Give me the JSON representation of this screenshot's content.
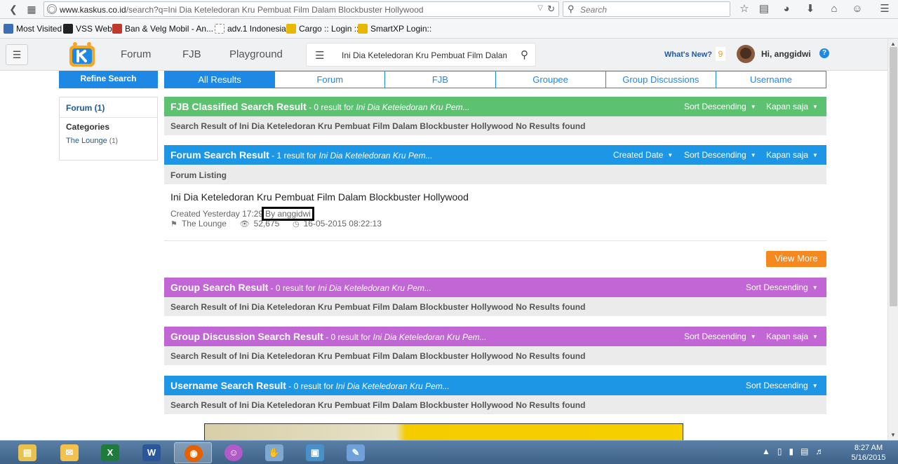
{
  "browser": {
    "url_domain": "www.kaskus.co.id",
    "url_path": "/search?q=Ini Dia Keteledoran Kru Pembuat Film Dalam Blockbuster Hollywood",
    "search_placeholder": "Search"
  },
  "bookmarks": [
    {
      "label": "Most Visited",
      "color": "#3b6fb6"
    },
    {
      "label": "VSS Web",
      "color": "#222222"
    },
    {
      "label": "Ban & Velg Mobil - An...",
      "color": "#c0392b"
    },
    {
      "label": "adv.1 Indonesia",
      "color": "#ffffff"
    },
    {
      "label": "Cargo :: Login ::",
      "color": "#e6b800"
    },
    {
      "label": "SmartXP Login::",
      "color": "#e6b800"
    }
  ],
  "header": {
    "nav": [
      "Forum",
      "FJB",
      "Playground"
    ],
    "search_value": "Ini Dia Keteledoran Kru Pembuat Film Dalam Blockbuster Hollywood",
    "whats_new": "What's New?",
    "notif_count": "9",
    "greeting": "Hi, anggidwi",
    "help": "?"
  },
  "sidebar": {
    "refine_label": "Refine Search",
    "forum_filter": "Forum (1)",
    "categories_heading": "Categories",
    "category_item": "The Lounge",
    "category_count": "(1)"
  },
  "tabs": [
    "All Results",
    "Forum",
    "FJB",
    "Groupee",
    "Group Discussions",
    "Username"
  ],
  "sections": {
    "fjb": {
      "title": "FJB Classified Search Result",
      "sub_prefix": " - 0 result for ",
      "sub_query": "Ini Dia Keteledoran Kru Pem...",
      "sort": "Sort Descending",
      "time": "Kapan saja",
      "no_result": "Search Result of Ini Dia Keteledoran Kru Pembuat Film Dalam Blockbuster Hollywood No Results found"
    },
    "forum": {
      "title": "Forum Search Result",
      "sub_prefix": " - 1 result for ",
      "sub_query": "Ini Dia Keteledoran Kru Pem...",
      "created_date": "Created Date",
      "sort": "Sort Descending",
      "time": "Kapan saja",
      "listing_heading": "Forum Listing",
      "item": {
        "title": "Ini Dia Keteledoran Kru Pembuat Film Dalam Blockbuster Hollywood",
        "created": "Created Yesterday 17:29",
        "by": "By anggidwi",
        "category": "The Lounge",
        "views": "52,675",
        "last_post": "16-05-2015 08:22:13"
      },
      "view_more": "View More"
    },
    "group": {
      "title": "Group Search Result",
      "sub_prefix": " - 0 result for ",
      "sub_query": "Ini Dia Keteledoran Kru Pem...",
      "sort": "Sort Descending",
      "no_result": "Search Result of Ini Dia Keteledoran Kru Pembuat Film Dalam Blockbuster Hollywood No Results found"
    },
    "group_discussion": {
      "title": "Group Discussion Search Result",
      "sub_prefix": " - 0 result for ",
      "sub_query": "Ini Dia Keteledoran Kru Pem...",
      "sort": "Sort Descending",
      "time": "Kapan saja",
      "no_result": "Search Result of Ini Dia Keteledoran Kru Pembuat Film Dalam Blockbuster Hollywood No Results found"
    },
    "username": {
      "title": "Username Search Result",
      "sub_prefix": " - 0 result for ",
      "sub_query": "Ini Dia Keteledoran Kru Pem...",
      "sort": "Sort Descending",
      "no_result": "Search Result of Ini Dia Keteledoran Kru Pembuat Film Dalam Blockbuster Hollywood No Results found"
    }
  },
  "colors": {
    "fjb_header": "#5cc171",
    "forum_header": "#1e96e6",
    "group_header": "#c266d6",
    "view_more": "#f5891f",
    "tab_accent": "#1e88e5"
  },
  "taskbar": {
    "apps": [
      "file-explorer",
      "outlook",
      "excel",
      "word",
      "firefox",
      "messenger",
      "hand-tool",
      "photo-viewer",
      "paint"
    ],
    "clock_time": "8:27 AM",
    "clock_date": "5/16/2015"
  }
}
